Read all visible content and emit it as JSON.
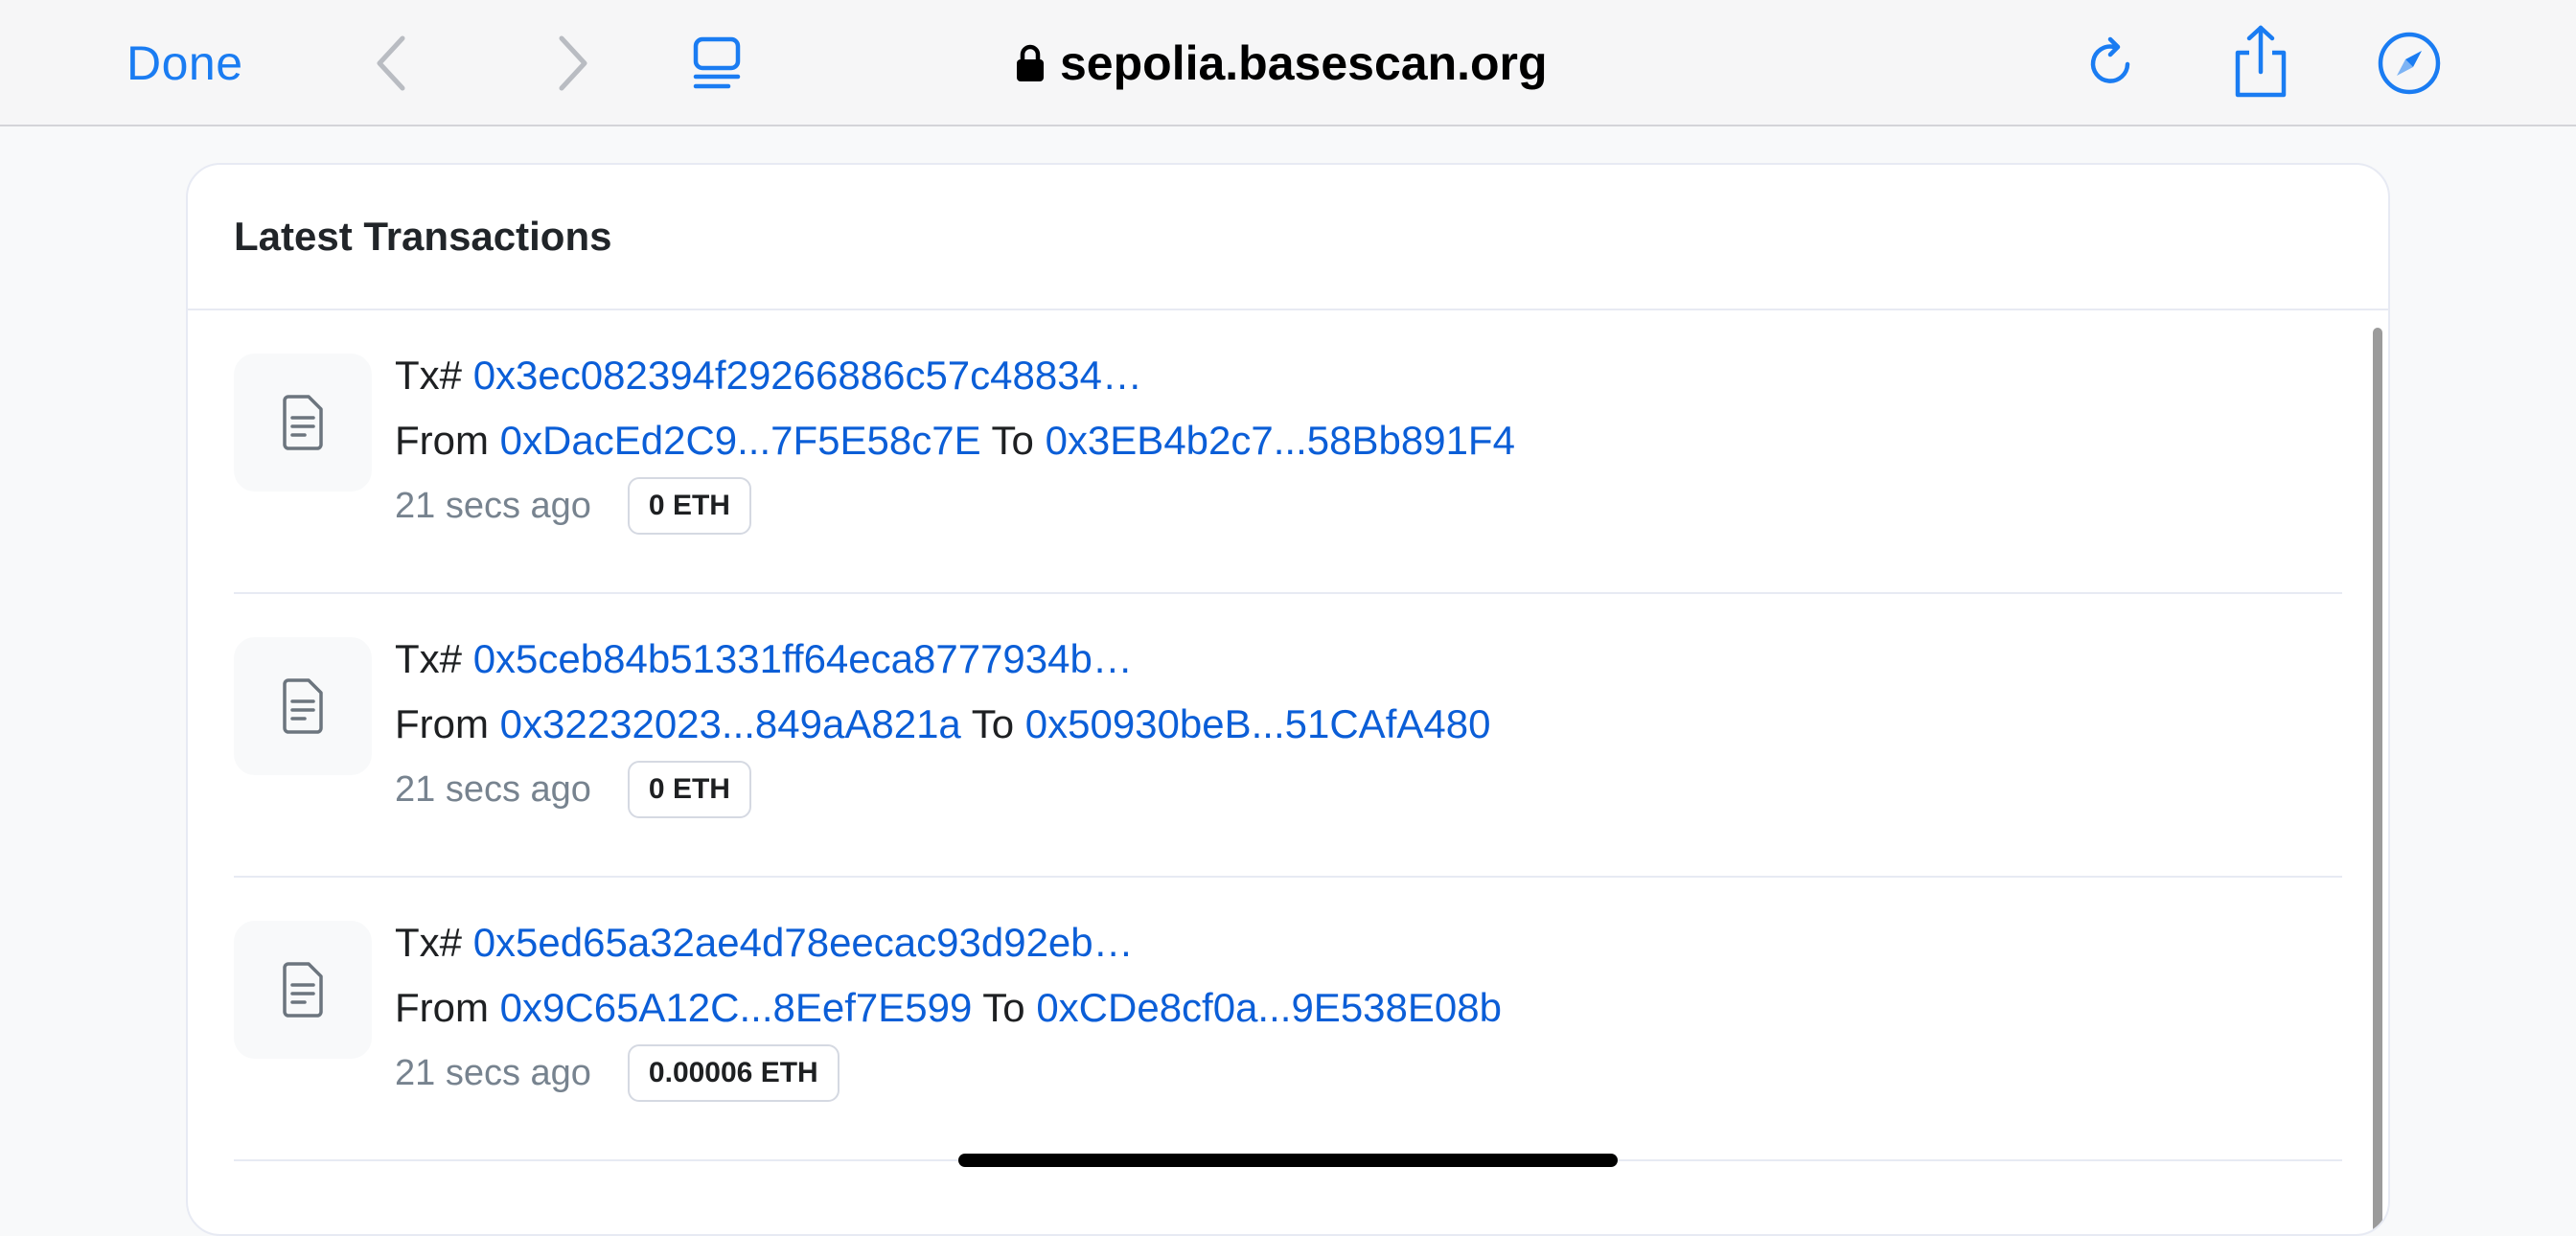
{
  "browser": {
    "done_label": "Done",
    "url": "sepolia.basescan.org",
    "accent_color": "#1a7cf2",
    "icons": {
      "back": "chevron-left-icon",
      "forward": "chevron-right-icon",
      "tabs": "tab-overview-icon",
      "lock": "lock-icon",
      "reload": "reload-icon",
      "share": "share-icon",
      "compass": "compass-icon"
    }
  },
  "card": {
    "title": "Latest Transactions",
    "link_color": "#0b5ed7",
    "transactions": [
      {
        "tx_label": "Tx#",
        "tx_hash": "0x3ec082394f29266886c57c48834…",
        "from_label": "From",
        "from": "0xDacEd2C9...7F5E58c7E",
        "to_label": "To",
        "to": "0x3EB4b2c7...58Bb891F4",
        "age": "21 secs ago",
        "value": "0 ETH",
        "icon": "document-icon"
      },
      {
        "tx_label": "Tx#",
        "tx_hash": "0x5ceb84b51331ff64eca8777934b…",
        "from_label": "From",
        "from": "0x32232023...849aA821a",
        "to_label": "To",
        "to": "0x50930beB...51CAfA480",
        "age": "21 secs ago",
        "value": "0 ETH",
        "icon": "document-icon"
      },
      {
        "tx_label": "Tx#",
        "tx_hash": "0x5ed65a32ae4d78eecac93d92eb…",
        "from_label": "From",
        "from": "0x9C65A12C...8Eef7E599",
        "to_label": "To",
        "to": "0xCDe8cf0a...9E538E08b",
        "age": "21 secs ago",
        "value": "0.00006 ETH",
        "icon": "document-icon"
      }
    ]
  }
}
